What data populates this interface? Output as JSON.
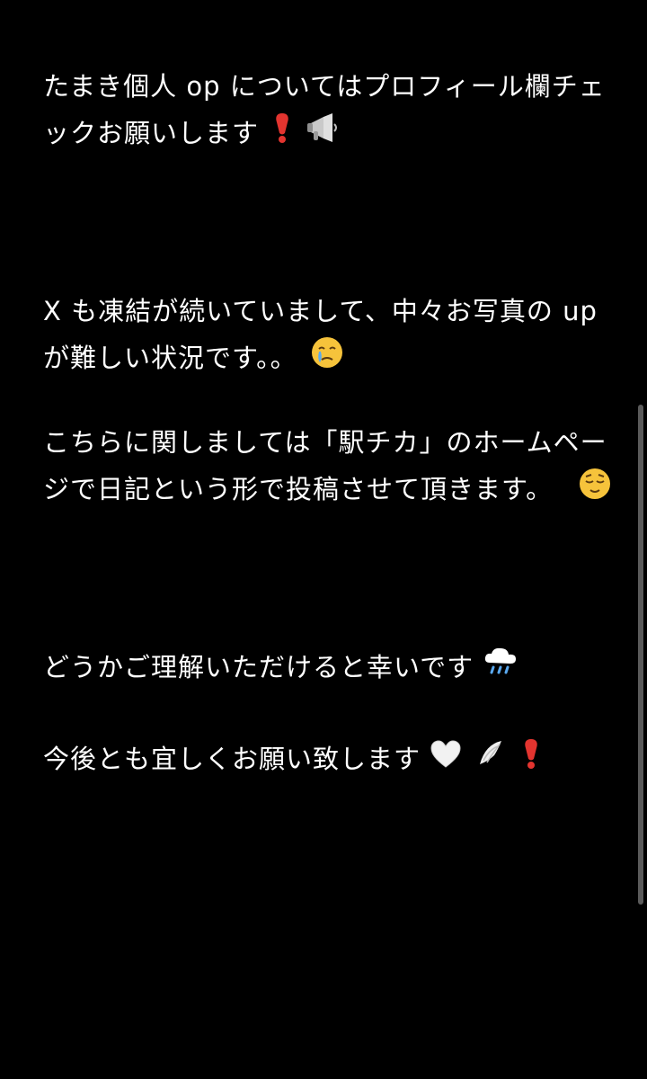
{
  "note": {
    "paragraphs": [
      {
        "lines": [
          "たまき個人 op についてはプロフィール欄チェ",
          "ックお願いします"
        ],
        "emoji": [
          "exclamation-icon",
          "megaphone-icon"
        ]
      },
      {
        "lines": [
          "X も凍結が続いていまして、中々お写真の up",
          "が難しい状況です。。"
        ],
        "emoji": [
          "crying-face-icon"
        ]
      },
      {
        "lines": [
          "こちらに関しましては「駅チカ」のホームペー",
          "ジで日記という形で投稿させて頂きます。"
        ],
        "emoji": [
          "relieved-face-icon"
        ]
      },
      {
        "lines": [
          "どうかご理解いただけると幸いです"
        ],
        "emoji": [
          "rain-cloud-icon"
        ]
      },
      {
        "lines": [
          "今後とも宜しくお願い致します"
        ],
        "emoji": [
          "white-heart-icon",
          "wing-icon",
          "exclamation-icon"
        ]
      }
    ]
  },
  "colors": {
    "background": "#000000",
    "text": "#ffffff",
    "scrollbar": "#5a5a5a",
    "exclamation": "#e3342f",
    "emoji_face": "#f6c33b"
  }
}
